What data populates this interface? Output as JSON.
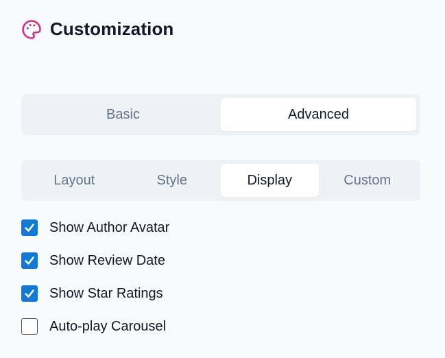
{
  "header": {
    "title": "Customization",
    "icon": "palette-icon",
    "icon_color": "#db2777"
  },
  "mode_tabs": [
    {
      "label": "Basic",
      "active": false
    },
    {
      "label": "Advanced",
      "active": true
    }
  ],
  "section_tabs": [
    {
      "label": "Layout",
      "active": false
    },
    {
      "label": "Style",
      "active": false
    },
    {
      "label": "Display",
      "active": true
    },
    {
      "label": "Custom",
      "active": false
    }
  ],
  "display_options": [
    {
      "label": "Show Author Avatar",
      "checked": true
    },
    {
      "label": "Show Review Date",
      "checked": true
    },
    {
      "label": "Show Star Ratings",
      "checked": true
    },
    {
      "label": "Auto-play Carousel",
      "checked": false
    }
  ],
  "colors": {
    "checkbox_accent": "#0f7ad8",
    "segment_bg": "#eef2f7",
    "inactive_tab_text": "#64748b"
  }
}
